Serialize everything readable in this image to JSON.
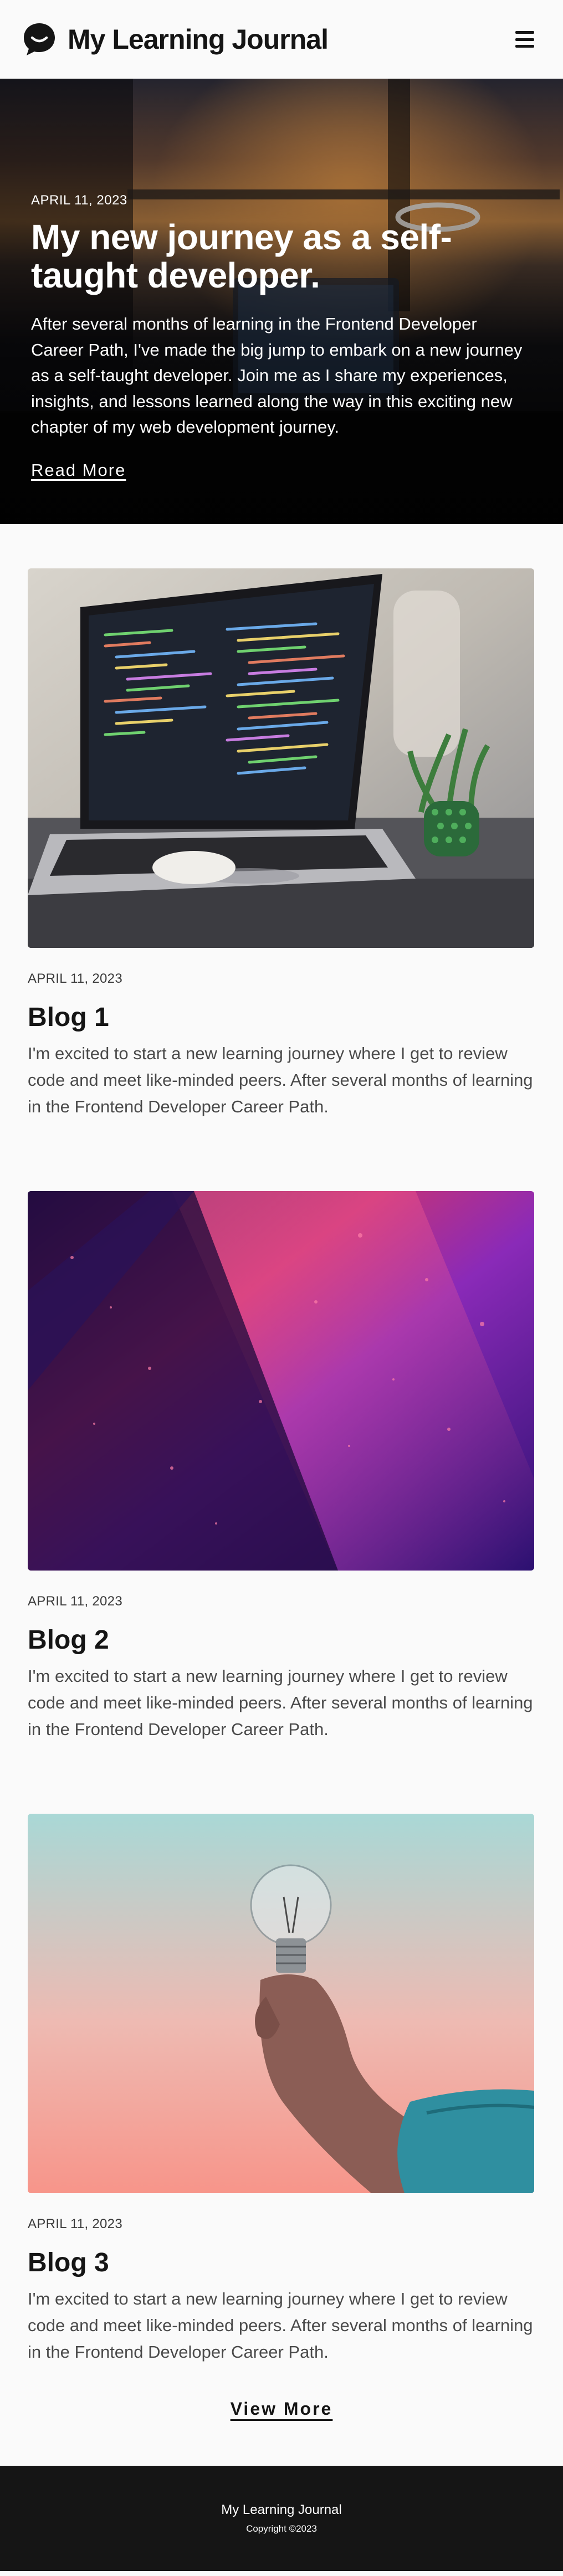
{
  "header": {
    "title": "My Learning Journal",
    "logo_icon": "speech-bubble-smile-icon",
    "menu_icon": "hamburger-menu-icon"
  },
  "hero": {
    "date": "APRIL 11, 2023",
    "title": "My new journey as a self-taught developer.",
    "text": "After several months of learning in the Frontend Developer Career Path, I've made the big jump to embark on a new journey as a self-taught developer. Join me as I share my experiences, insights, and lessons learned along the way in this exciting new chapter of my web development journey.",
    "link": "Read More"
  },
  "posts": [
    {
      "date": "APRIL 11, 2023",
      "title": "Blog 1",
      "text": "I'm excited to start a new learning journey where I get to review code and meet like-minded peers. After several months of learning in the Frontend Developer Career Path."
    },
    {
      "date": "APRIL 11, 2023",
      "title": "Blog 2",
      "text": "I'm excited to start a new learning journey where I get to review code and meet like-minded peers. After several months of learning in the Frontend Developer Career Path."
    },
    {
      "date": "APRIL 11, 2023",
      "title": "Blog 3",
      "text": "I'm excited to start a new learning journey where I get to review code and meet like-minded peers. After several months of learning in the Frontend Developer Career Path."
    }
  ],
  "view_more": "View More",
  "footer": {
    "title": "My Learning Journal",
    "copyright": "Copyright ©2023"
  },
  "colors": {
    "text": "#151515",
    "background": "#fafafa",
    "footer": "#151515"
  }
}
